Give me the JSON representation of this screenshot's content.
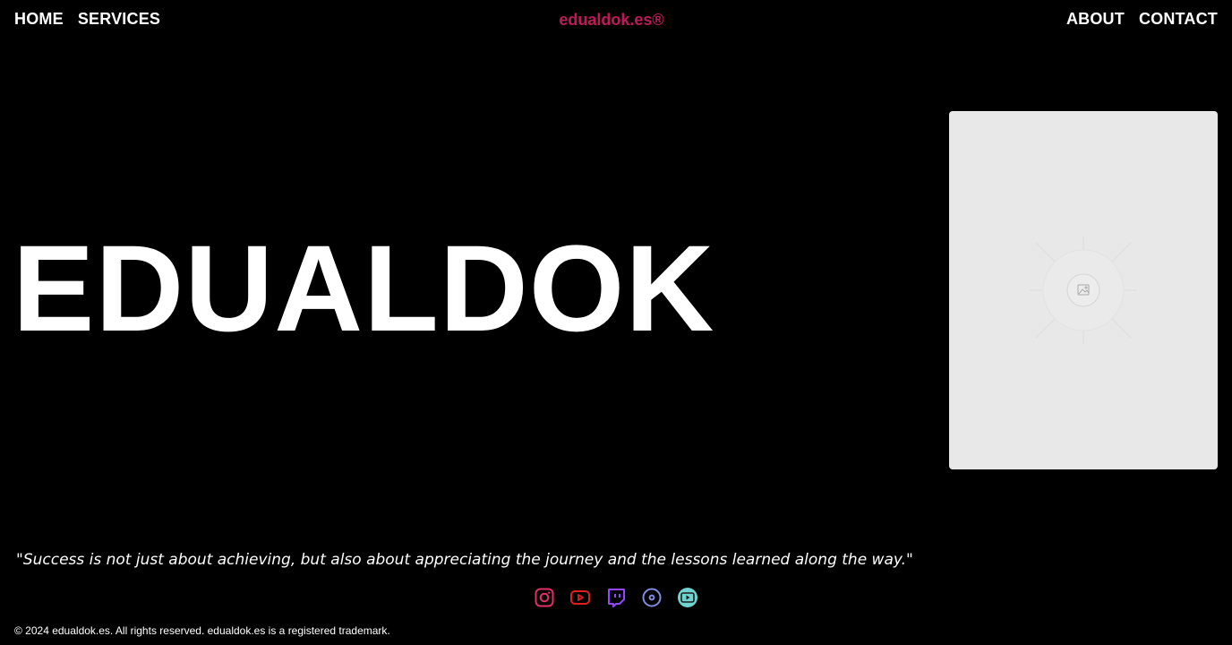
{
  "nav": {
    "left": [
      {
        "label": "HOME"
      },
      {
        "label": "SERVICES"
      }
    ],
    "right": [
      {
        "label": "ABOUT"
      },
      {
        "label": "CONTACT"
      }
    ],
    "brand": "edualdok.es®"
  },
  "hero": {
    "title": "EDUALDOK",
    "image_placeholder_icon": "image-placeholder-icon"
  },
  "quote": "\"Success is not just about achieving, but also about appreciating the journey and the lessons learned along the way.\"",
  "social": [
    {
      "icon": "instagram-icon",
      "color": "#e1306c"
    },
    {
      "icon": "youtube-icon",
      "color": "#e02020"
    },
    {
      "icon": "twitch-icon",
      "color": "#9146ff"
    },
    {
      "icon": "disc-icon",
      "color": "#7f8ce0"
    },
    {
      "icon": "video-play-icon",
      "color": "#6fd3cf"
    }
  ],
  "footer": "© 2024 edualdok.es. All rights reserved. edualdok.es is a registered trademark.",
  "colors": {
    "background": "#000000",
    "brand": "#c2185b",
    "text": "#ffffff",
    "card": "#e8e8e8"
  }
}
